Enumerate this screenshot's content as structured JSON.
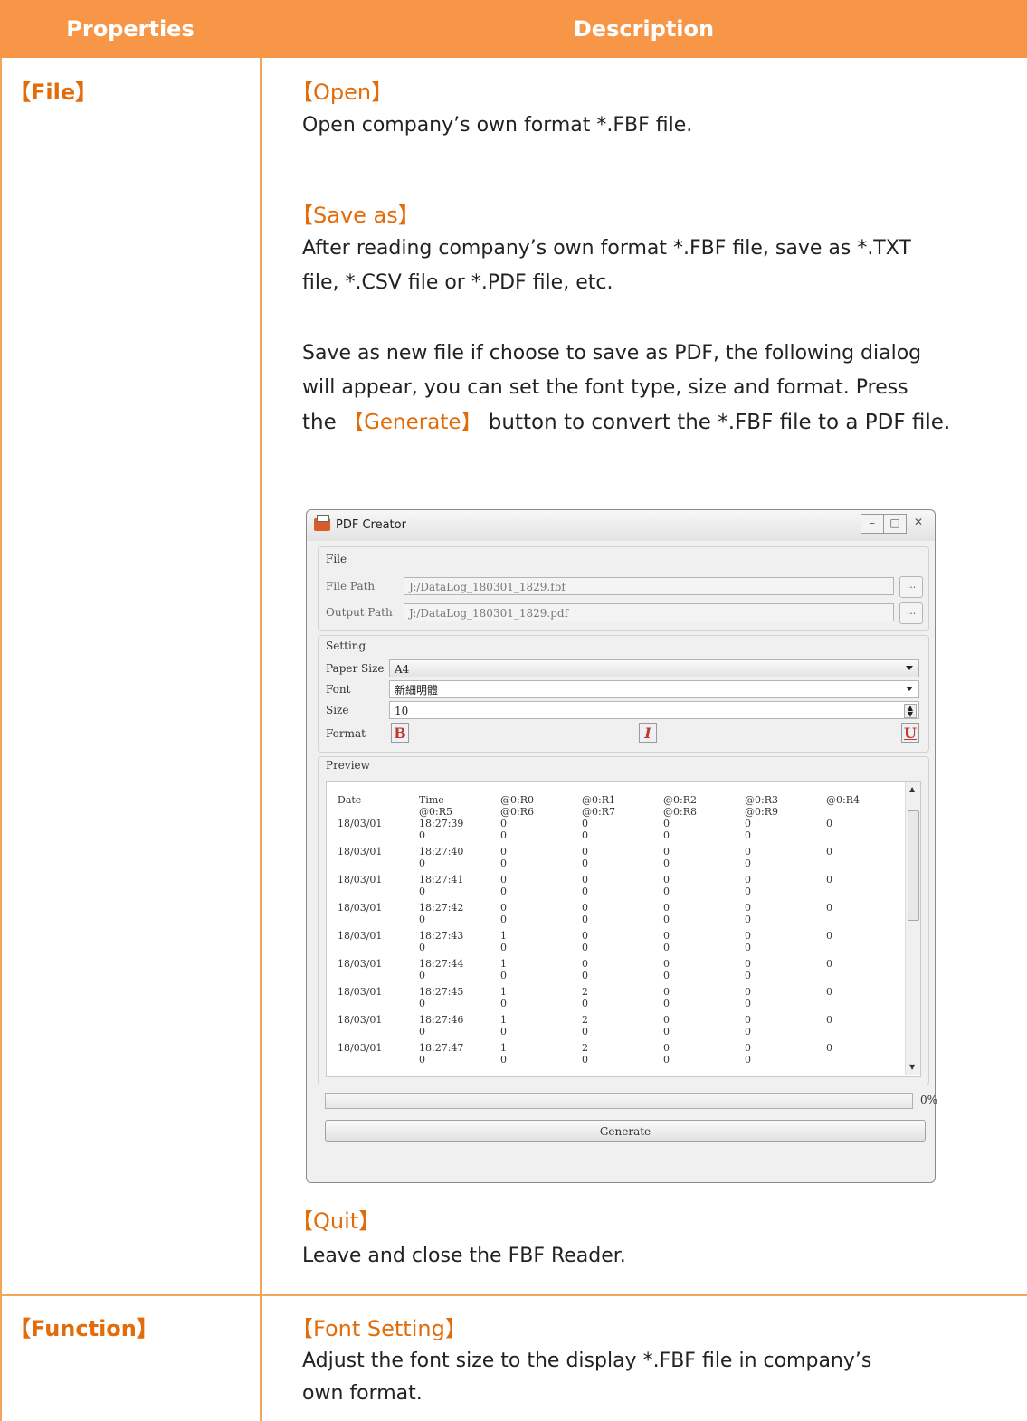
{
  "table": {
    "header": {
      "col1": "Properties",
      "col2": "Description"
    },
    "rows": [
      {
        "property": "【File】",
        "sections": [
          {
            "title": "【Open】",
            "text": [
              "Open company’s own format *.FBF file."
            ]
          },
          {
            "title": "【Save as】",
            "text": [
              "After reading company’s own format *.FBF file, save as *.TXT",
              "file, *.CSV file or *.PDF file, etc."
            ]
          },
          {
            "text": [
              "Save as new file if choose to save as PDF, the following dialog",
              "will appear, you can set the font type, size and format. Press"
            ]
          },
          {
            "text_a": "the",
            "highlight": "【Generate】",
            "text_b": "button to convert the *.FBF file to a PDF file."
          },
          {
            "title": "【Quit】",
            "text": [
              "Leave and close the FBF Reader."
            ]
          }
        ]
      },
      {
        "property": "【Function】",
        "sections": [
          {
            "title": "【Font Setting】",
            "text": [
              "Adjust the font size to the display *.FBF file in company’s",
              "own format."
            ]
          }
        ]
      }
    ]
  },
  "dialog": {
    "title": "PDF Creator",
    "window_buttons": [
      "–",
      "□",
      "✕"
    ],
    "file_group": {
      "label": "File",
      "file_path_label": "File Path",
      "file_path_value": "J:/DataLog_180301_1829.fbf",
      "output_path_label": "Output Path",
      "output_path_value": "J:/DataLog_180301_1829.pdf",
      "browse_label": "..."
    },
    "setting_group": {
      "label": "Setting",
      "paper_size_label": "Paper Size",
      "paper_size_value": "A4",
      "font_label": "Font",
      "font_value": "新細明體",
      "size_label": "Size",
      "size_value": "10",
      "format_label": "Format",
      "bold": "B",
      "italic": "I",
      "underline": "U"
    },
    "preview_group": {
      "label": "Preview",
      "headers": [
        "Date",
        "Time",
        "@0:R0",
        "@0:R1",
        "@0:R2",
        "@0:R3",
        "@0:R4"
      ],
      "headers2": [
        "",
        "@0:R5",
        "@0:R6",
        "@0:R7",
        "@0:R8",
        "@0:R9",
        ""
      ],
      "rows": [
        {
          "date": "18/03/01",
          "time": "18:27:39",
          "r0": "0",
          "r1": "0",
          "r2": "0",
          "r3": "0",
          "r4": "0",
          "r5": "0",
          "r6": "0",
          "r7": "0",
          "r8": "0",
          "r9": "0"
        },
        {
          "date": "18/03/01",
          "time": "18:27:40",
          "r0": "0",
          "r1": "0",
          "r2": "0",
          "r3": "0",
          "r4": "0",
          "r5": "0",
          "r6": "0",
          "r7": "0",
          "r8": "0",
          "r9": "0"
        },
        {
          "date": "18/03/01",
          "time": "18:27:41",
          "r0": "0",
          "r1": "0",
          "r2": "0",
          "r3": "0",
          "r4": "0",
          "r5": "0",
          "r6": "0",
          "r7": "0",
          "r8": "0",
          "r9": "0"
        },
        {
          "date": "18/03/01",
          "time": "18:27:42",
          "r0": "0",
          "r1": "0",
          "r2": "0",
          "r3": "0",
          "r4": "0",
          "r5": "0",
          "r6": "0",
          "r7": "0",
          "r8": "0",
          "r9": "0"
        },
        {
          "date": "18/03/01",
          "time": "18:27:43",
          "r0": "1",
          "r1": "0",
          "r2": "0",
          "r3": "0",
          "r4": "0",
          "r5": "0",
          "r6": "0",
          "r7": "0",
          "r8": "0",
          "r9": "0"
        },
        {
          "date": "18/03/01",
          "time": "18:27:44",
          "r0": "1",
          "r1": "0",
          "r2": "0",
          "r3": "0",
          "r4": "0",
          "r5": "0",
          "r6": "0",
          "r7": "0",
          "r8": "0",
          "r9": "0"
        },
        {
          "date": "18/03/01",
          "time": "18:27:45",
          "r0": "1",
          "r1": "2",
          "r2": "0",
          "r3": "0",
          "r4": "0",
          "r5": "0",
          "r6": "0",
          "r7": "0",
          "r8": "0",
          "r9": "0"
        },
        {
          "date": "18/03/01",
          "time": "18:27:46",
          "r0": "1",
          "r1": "2",
          "r2": "0",
          "r3": "0",
          "r4": "0",
          "r5": "0",
          "r6": "0",
          "r7": "0",
          "r8": "0",
          "r9": "0"
        },
        {
          "date": "18/03/01",
          "time": "18:27:47",
          "r0": "1",
          "r1": "2",
          "r2": "0",
          "r3": "0",
          "r4": "0",
          "r5": "0",
          "r6": "0",
          "r7": "0",
          "r8": "0",
          "r9": "0"
        }
      ]
    },
    "progress": {
      "value": 0,
      "label": "0%"
    },
    "generate_label": "Generate"
  },
  "colors": {
    "header_bg": "#f79646",
    "accent": "#e36c0a",
    "border": "#f2a65a"
  }
}
